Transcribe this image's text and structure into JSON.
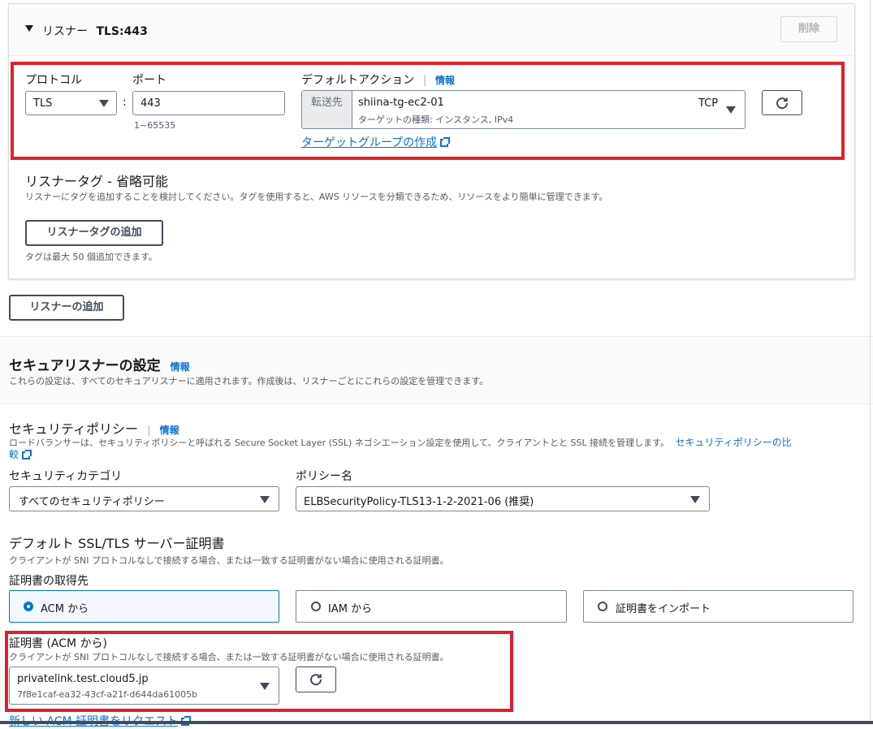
{
  "listener": {
    "header_prefix": "リスナー",
    "header_name": "TLS:443",
    "delete_label": "削除",
    "protocol_label": "プロトコル",
    "protocol_value": "TLS",
    "colon": ":",
    "port_label": "ポート",
    "port_value": "443",
    "port_hint": "1~65535",
    "default_action_label": "デフォルトアクション",
    "info_label": "情報",
    "forward_label": "転送先",
    "target_name": "shiina-tg-ec2-01",
    "target_sub": "ターゲットの種類: インスタンス, IPv4",
    "target_protocol": "TCP",
    "create_tg_link": "ターゲットグループの作成",
    "tags_title": "リスナータグ - 省略可能",
    "tags_desc": "リスナーにタグを追加することを検討してください。タグを使用すると、AWS リソースを分類できるため、リソースをより簡単に管理できます。",
    "add_tag_button": "リスナータグの追加",
    "tag_limit": "タグは最大 50 個追加できます。"
  },
  "add_listener_button": "リスナーの追加",
  "secure": {
    "title": "セキュアリスナーの設定",
    "info_label": "情報",
    "desc": "これらの設定は、すべてのセキュアリスナーに適用されます。作成後は、リスナーごとにこれらの設定を管理できます。",
    "policy_title": "セキュリティポリシー",
    "policy_info": "情報",
    "policy_desc": "ロードバランサーは、セキュリティポリシーと呼ばれる Secure Socket Layer (SSL) ネゴシエーション設定を使用して、クライアントとと SSL 接続を管理します。",
    "policy_compare_link_1": "セキュリティポリシーの比",
    "policy_compare_link_2": "較",
    "category_label": "セキュリティカテゴリ",
    "category_value": "すべてのセキュリティポリシー",
    "policy_name_label": "ポリシー名",
    "policy_name_value": "ELBSecurityPolicy-TLS13-1-2-2021-06 (推奨)",
    "cert_title": "デフォルト SSL/TLS サーバー証明書",
    "cert_desc": "クライアントが SNI プロトコルなしで接続する場合、または一致する証明書がない場合に使用される証明書。",
    "cert_source_label": "証明書の取得先",
    "source_options": [
      "ACM から",
      "IAM から",
      "証明書をインポート"
    ],
    "acm_cert_label": "証明書 (ACM から)",
    "acm_cert_desc": "クライアントが SNI プロトコルなしで接続する場合、または一致する証明書がない場合に使用される証明書。",
    "cert_name": "privatelink.test.cloud5.jp",
    "cert_id": "7f8e1caf-ea32-43cf-a21f-d644da61005b",
    "request_link": "新しい ACM 証明書をリクエスト"
  },
  "colors": {
    "highlight": "#e0202a",
    "link": "#0972d3",
    "selected_bg": "#f2f8fd"
  }
}
